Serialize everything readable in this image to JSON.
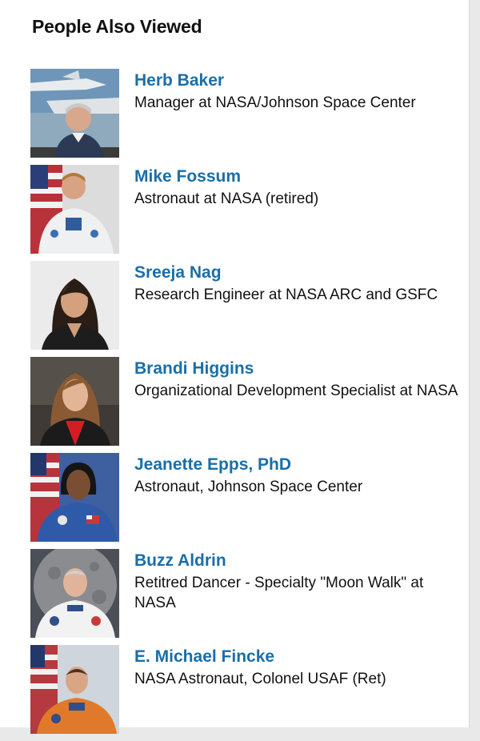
{
  "section": {
    "heading": "People Also Viewed"
  },
  "people": [
    {
      "name": "Herb Baker",
      "title": "Manager at NASA/Johnson Space Center"
    },
    {
      "name": "Mike Fossum",
      "title": "Astronaut at NASA (retired)"
    },
    {
      "name": "Sreeja Nag",
      "title": "Research Engineer at NASA ARC and GSFC"
    },
    {
      "name": "Brandi Higgins",
      "title": "Organizational Development Specialist at NASA"
    },
    {
      "name": "Jeanette Epps, PhD",
      "title": "Astronaut, Johnson Space Center"
    },
    {
      "name": "Buzz Aldrin",
      "title": "Retitred Dancer - Specialty \"Moon Walk\" at NASA"
    },
    {
      "name": "E. Michael Fincke",
      "title": "NASA Astronaut, Colonel USAF (Ret)"
    }
  ],
  "colors": {
    "name_link": "#1a6ea7",
    "heading_text": "#111111",
    "page_background": "#e9e9e9"
  }
}
